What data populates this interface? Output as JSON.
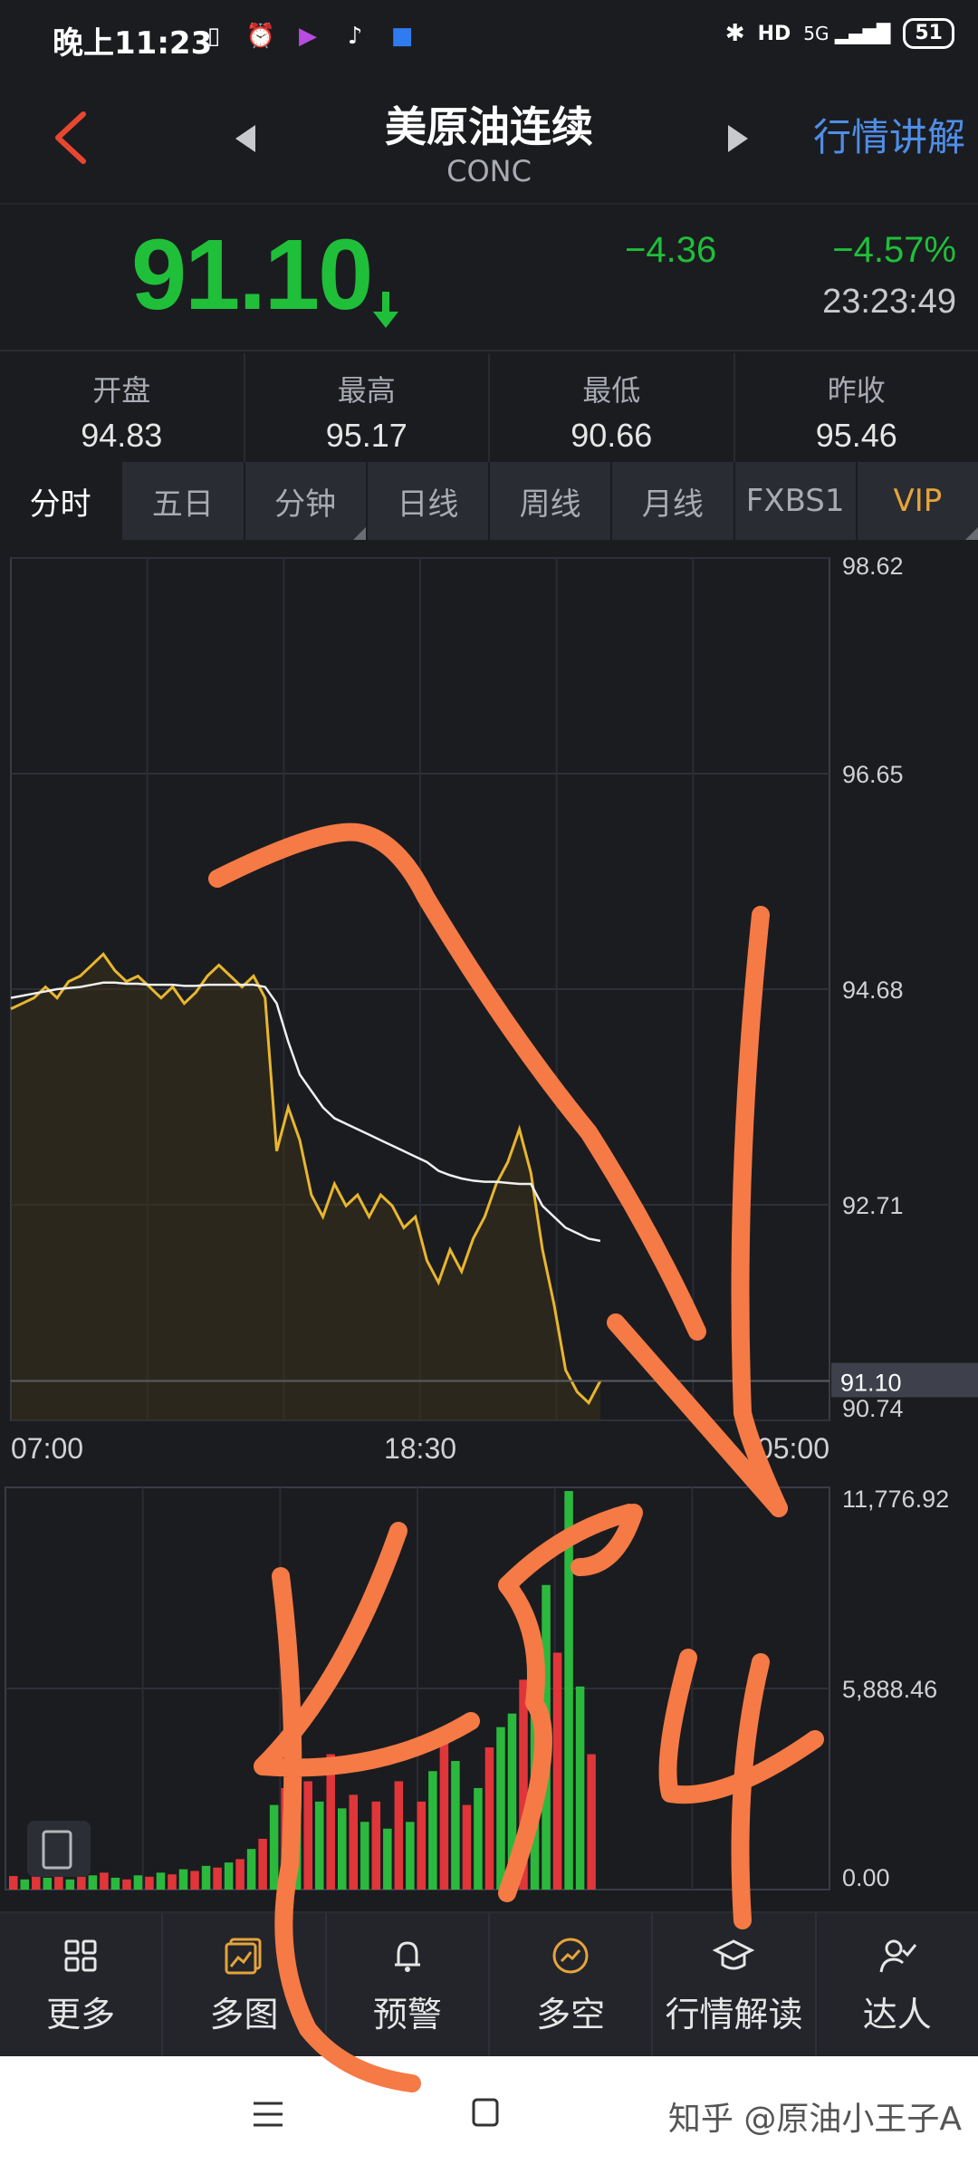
{
  "status": {
    "time": "晚上11:23",
    "battery": "51"
  },
  "header": {
    "title": "美原油连续",
    "code": "CONC",
    "right_link": "行情讲解"
  },
  "quote": {
    "price": "91.10",
    "change": "−4.36",
    "change_pct": "−4.57%",
    "time": "23:23:49"
  },
  "stats": [
    {
      "label": "开盘",
      "value": "94.83"
    },
    {
      "label": "最高",
      "value": "95.17"
    },
    {
      "label": "最低",
      "value": "90.66"
    },
    {
      "label": "昨收",
      "value": "95.46"
    }
  ],
  "tabs": [
    "分时",
    "五日",
    "分钟",
    "日线",
    "周线",
    "月线",
    "FXBS1",
    "VIP"
  ],
  "chart_data": {
    "type": "line",
    "y_ticks": [
      "98.62",
      "96.65",
      "94.68",
      "92.71",
      "90.74"
    ],
    "ylim": [
      90.74,
      98.62
    ],
    "x_ticks": [
      "07:00",
      "18:30",
      "05:00"
    ],
    "current_price_label": "91.10",
    "series": [
      {
        "values": [
          94.5,
          94.55,
          94.6,
          94.7,
          94.6,
          94.75,
          94.8,
          94.9,
          95.0,
          94.85,
          94.75,
          94.8,
          94.7,
          94.6,
          94.7,
          94.55,
          94.65,
          94.8,
          94.9,
          94.8,
          94.7,
          94.8,
          94.6,
          93.2,
          93.6,
          93.3,
          92.8,
          92.6,
          92.9,
          92.7,
          92.8,
          92.6,
          92.8,
          92.7,
          92.5,
          92.6,
          92.2,
          92.0,
          92.3,
          92.1,
          92.4,
          92.6,
          92.9,
          93.1,
          93.4,
          93.0,
          92.3,
          91.8,
          91.2,
          91.0,
          90.9,
          91.1
        ]
      },
      {
        "values": [
          94.6,
          94.62,
          94.64,
          94.66,
          94.68,
          94.69,
          94.7,
          94.72,
          94.74,
          94.74,
          94.73,
          94.73,
          94.72,
          94.72,
          94.72,
          94.71,
          94.71,
          94.72,
          94.72,
          94.72,
          94.72,
          94.72,
          94.7,
          94.55,
          94.2,
          93.9,
          93.75,
          93.6,
          93.5,
          93.45,
          93.4,
          93.35,
          93.3,
          93.25,
          93.2,
          93.15,
          93.1,
          93.02,
          92.98,
          92.95,
          92.93,
          92.92,
          92.92,
          92.91,
          92.9,
          92.9,
          92.7,
          92.6,
          92.5,
          92.45,
          92.4,
          92.38
        ]
      }
    ],
    "volume": {
      "y_ticks": [
        "11,776.92",
        "5,888.46",
        "0.00"
      ],
      "ylim": [
        0,
        11776.92
      ],
      "values": [
        400,
        300,
        500,
        350,
        450,
        300,
        380,
        420,
        500,
        350,
        300,
        420,
        380,
        500,
        450,
        600,
        550,
        700,
        650,
        800,
        900,
        1200,
        1500,
        2500,
        3000,
        2200,
        3200,
        2600,
        4000,
        2400,
        2800,
        2000,
        2600,
        1800,
        3200,
        2000,
        2600,
        3500,
        4500,
        3800,
        2500,
        3000,
        4200,
        4800,
        5200,
        6200,
        5800,
        9000,
        7000,
        11776,
        6000,
        4000
      ],
      "colors": [
        "r",
        "g",
        "r",
        "g",
        "r",
        "g",
        "r",
        "g",
        "r",
        "g",
        "r",
        "g",
        "r",
        "g",
        "r",
        "g",
        "r",
        "g",
        "r",
        "g",
        "r",
        "g",
        "r",
        "g",
        "r",
        "g",
        "r",
        "g",
        "r",
        "g",
        "r",
        "g",
        "r",
        "g",
        "r",
        "g",
        "r",
        "g",
        "r",
        "g",
        "r",
        "g",
        "r",
        "g",
        "g",
        "r",
        "g",
        "g",
        "r",
        "g",
        "g",
        "r"
      ]
    }
  },
  "toolbar": [
    {
      "label": "更多",
      "icon": "grid-icon"
    },
    {
      "label": "多图",
      "icon": "multi-chart-icon"
    },
    {
      "label": "预警",
      "icon": "bell-icon"
    },
    {
      "label": "多空",
      "icon": "trend-icon"
    },
    {
      "label": "行情解读",
      "icon": "graduate-icon"
    },
    {
      "label": "达人",
      "icon": "user-check-icon"
    }
  ],
  "annotation": {
    "text": "454"
  },
  "watermark": "知乎 @原油小王子A"
}
